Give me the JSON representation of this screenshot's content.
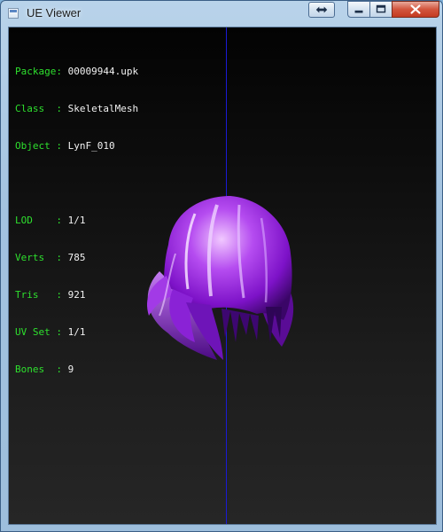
{
  "window": {
    "title": "UE Viewer",
    "icon": "app-window-icon"
  },
  "titlebar_buttons": {
    "swap": "swap-arrows-icon",
    "minimize": "minimize-icon",
    "maximize": "maximize-icon",
    "close": "close-icon"
  },
  "info": {
    "package": {
      "label": "Package",
      "sep": ": ",
      "value": "00009944.upk"
    },
    "class": {
      "label": "Class  ",
      "sep": ": ",
      "value": "SkeletalMesh"
    },
    "object": {
      "label": "Object ",
      "sep": ": ",
      "value": "LynF_010"
    },
    "lod": {
      "label": "LOD    ",
      "sep": ": ",
      "value": "1/1"
    },
    "verts": {
      "label": "Verts  ",
      "sep": ": ",
      "value": "785"
    },
    "tris": {
      "label": "Tris   ",
      "sep": ": ",
      "value": "921"
    },
    "uvset": {
      "label": "UV Set ",
      "sep": ": ",
      "value": "1/1"
    },
    "bones": {
      "label": "Bones  ",
      "sep": ": ",
      "value": "9"
    }
  },
  "colors": {
    "label_green": "#2ee02e",
    "value_white": "#f2f2f2",
    "axis_blue": "#1a1ad6",
    "mesh_purple": "#9b1ee0"
  }
}
